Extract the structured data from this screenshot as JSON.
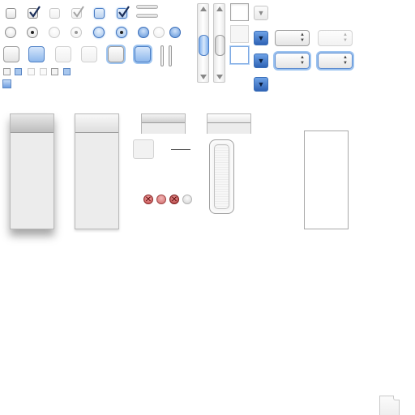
{
  "checkbox_glyph": "✓",
  "radio_glyph": "•",
  "popup_arrows": "▲▼",
  "dropdown_glyph": "▼",
  "scroll_arrow_up": "▲",
  "scroll_arrow_down": "▼",
  "close_glyph": "✕",
  "colors": {
    "accent_blue": "#5b8fd6",
    "focus_ring": "#9cc3f0",
    "close_red": "#d86a6a",
    "panel_gray": "#ececec"
  }
}
